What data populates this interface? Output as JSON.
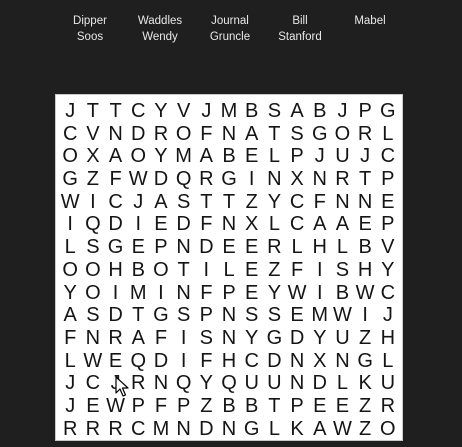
{
  "words": [
    [
      "Dipper",
      "Soos"
    ],
    [
      "Waddles",
      "Wendy"
    ],
    [
      "Journal",
      "Gruncle"
    ],
    [
      "Bill",
      "Stanford"
    ],
    [
      "Mabel",
      ""
    ]
  ],
  "grid": [
    "JTTCYVJMBSABJPG",
    "CVNDROFNATSGORL",
    "OXAOYMABELPJUJC",
    "GZFWDQRGINXNRTP",
    "WICJASTTZYCFNNE",
    "IQDIEDFNXLCAAEP",
    "LSGEPNDEERLHLBV",
    "OOHBOTILEZFISHY",
    "YOIMINFPEYWIBWC",
    "ASDTGSPNSSEMWIJ",
    "FNRAFISNYGDYUZH",
    "LWEQDIFHCDNXNGL",
    "JCJRNQYQUUNDLKU",
    "JEWPFPZBBTPEEZR",
    "RRRCMNDNGLKAWZO"
  ],
  "colors": {
    "background": "#1f1f1f",
    "board": "#ffffff",
    "letters": "#151515",
    "wordlist_text": "#e8e8e8"
  },
  "icons": [
    "mouse-pointer-icon"
  ]
}
